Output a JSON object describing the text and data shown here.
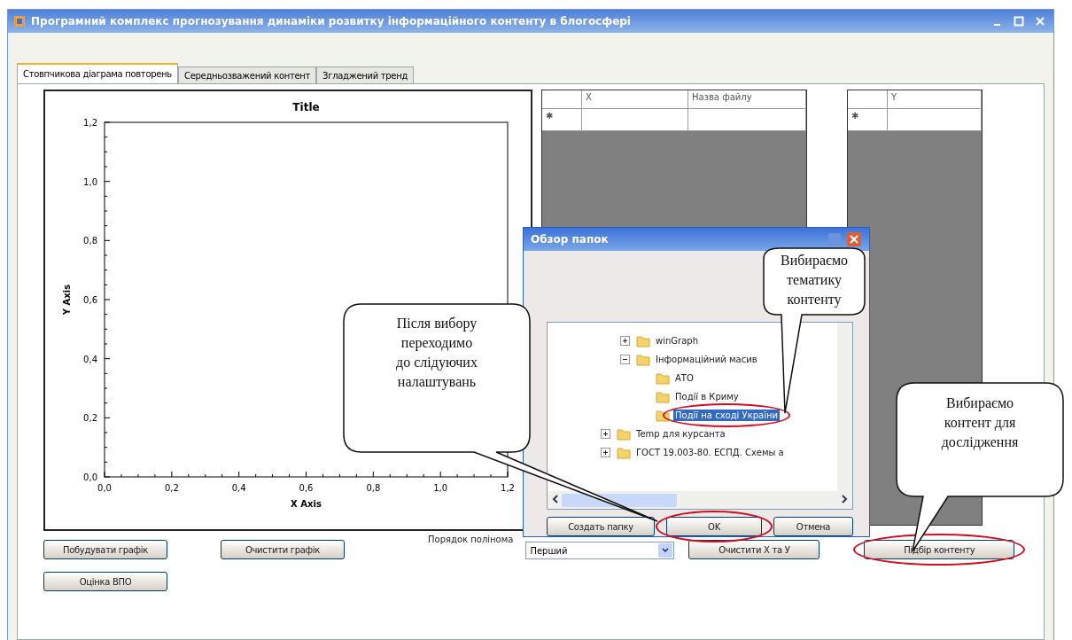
{
  "window": {
    "title": "Програмний комплекс прогнозування динаміки розвитку інформаційного контенту в блогосфері"
  },
  "tabs": [
    {
      "label": "Стовпчикова діаграма повторень",
      "selected": true
    },
    {
      "label": "Середньозважений контент",
      "selected": false
    },
    {
      "label": "Згладжений тренд",
      "selected": false
    }
  ],
  "chart": {
    "chart_data": {
      "type": "line",
      "title": "Title",
      "xlabel": "X Axis",
      "ylabel": "Y Axis",
      "xlim": [
        0,
        1.2
      ],
      "ylim": [
        0,
        1.2
      ],
      "xticks": [
        {
          "value": 0,
          "label": "0,0"
        },
        {
          "value": 0.2,
          "label": "0,2"
        },
        {
          "value": 0.4,
          "label": "0,4"
        },
        {
          "value": 0.6,
          "label": "0,6"
        },
        {
          "value": 0.8,
          "label": "0,8"
        },
        {
          "value": 1.0,
          "label": "1,0"
        },
        {
          "value": 1.2,
          "label": "1,2"
        }
      ],
      "yticks": [
        {
          "value": 0,
          "label": "0,0"
        },
        {
          "value": 0.2,
          "label": "0,2"
        },
        {
          "value": 0.4,
          "label": "0,4"
        },
        {
          "value": 0.6,
          "label": "0,6"
        },
        {
          "value": 0.8,
          "label": "0,8"
        },
        {
          "value": 1.0,
          "label": "1,0"
        },
        {
          "value": 1.2,
          "label": "1,2"
        }
      ]
    }
  },
  "grid_x": {
    "columns": [
      "X",
      "Назва файлу"
    ],
    "new_row_marker": "✱"
  },
  "grid_y": {
    "columns": [
      "Y"
    ],
    "new_row_marker": "✱"
  },
  "controls": [
    {
      "kind": "button",
      "label": "Побудувати графік",
      "circled": false
    },
    {
      "kind": "button",
      "label": "Очистити графік",
      "circled": false
    },
    {
      "kind": "label",
      "label": "Порядок полінома"
    },
    {
      "kind": "select",
      "value": "Перший"
    },
    {
      "kind": "button",
      "label": "Очистити X та У",
      "circled": false
    },
    {
      "kind": "button",
      "label": "Підбір контенту",
      "circled": true
    }
  ],
  "controls_row_2": [
    {
      "kind": "button",
      "label": "Оцінка ВПО",
      "circled": false
    }
  ],
  "dialog": {
    "title": "Обзор папок",
    "tree": [
      {
        "children": [
          {
            "label": "winGraph",
            "expanded": false,
            "selected": false,
            "circled": false
          },
          {
            "label": "Інформаційний масив",
            "expanded": true,
            "selected": false,
            "circled": false,
            "children": [
              {
                "label": "АТО",
                "selected": false,
                "circled": false
              },
              {
                "label": "Події в Криму",
                "selected": false,
                "circled": false
              },
              {
                "label": "Події на сході України",
                "selected": true,
                "circled": true
              }
            ]
          }
        ]
      },
      {
        "label": "Temp для курсанта",
        "expanded": false,
        "selected": false,
        "circled": false
      },
      {
        "label": "ГОСТ 19.003-80. ЕСПД. Схемы а",
        "expanded": false,
        "selected": false,
        "circled": false
      }
    ],
    "buttons": [
      {
        "label": "Создать папку",
        "circled": false
      },
      {
        "label": "OK",
        "circled": true
      },
      {
        "label": "Отмена",
        "circled": false
      }
    ]
  },
  "callouts": [
    "Вибираємо\nтематику\nконтенту",
    "Після вибору\nпереходимо\nдо слідуючих\nналаштувань",
    "Вибираємо\nконтент для\nдослідження"
  ]
}
